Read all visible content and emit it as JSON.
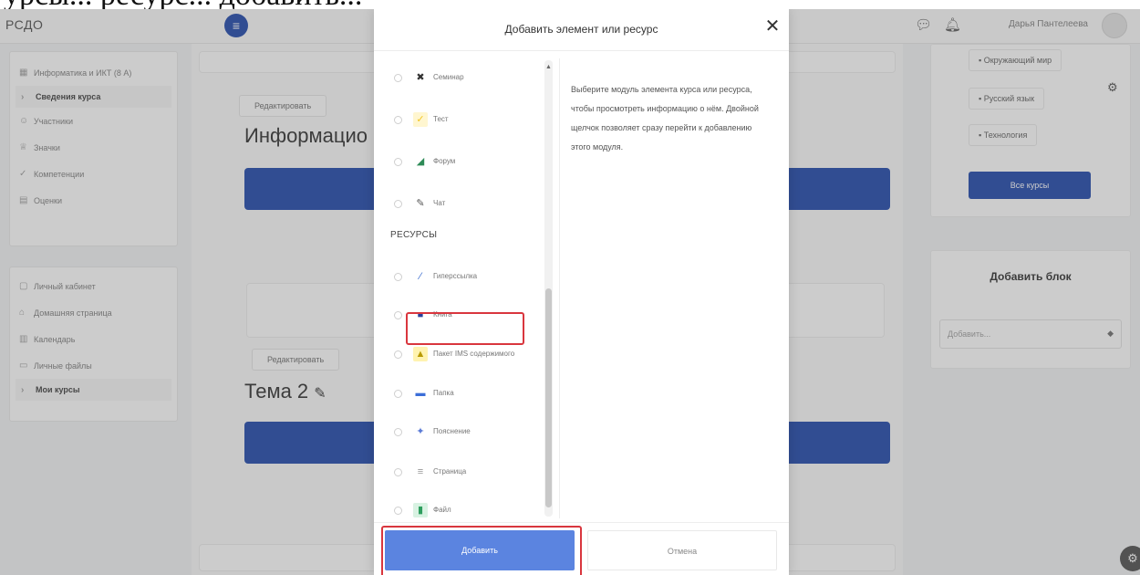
{
  "caption_fragment": "урсы... ресурс... добавить...",
  "app": {
    "brand": "РСДО",
    "user_name": "Дарья Пантелеева"
  },
  "sidebar": {
    "top_items": [
      {
        "label": "Информатика и ИКТ (8 А)",
        "icon": "grid-icon"
      },
      {
        "label": "Сведения курса",
        "icon": "chevron-icon"
      },
      {
        "label": "Участники",
        "icon": "users-icon"
      },
      {
        "label": "Значки",
        "icon": "badge-icon"
      },
      {
        "label": "Компетенции",
        "icon": "check-icon"
      },
      {
        "label": "Оценки",
        "icon": "table-icon"
      }
    ],
    "bottom_items": [
      {
        "label": "Личный кабинет",
        "icon": "dashboard-icon"
      },
      {
        "label": "Домашняя страница",
        "icon": "home-icon"
      },
      {
        "label": "Календарь",
        "icon": "calendar-icon"
      },
      {
        "label": "Личные файлы",
        "icon": "files-icon"
      },
      {
        "label": "Мои курсы",
        "icon": "chevron-icon"
      }
    ]
  },
  "center": {
    "edit_label_1": "Редактировать",
    "section_1_title": "Информацио",
    "edit_label_2": "Редактировать",
    "section_2_title": "Тема 2"
  },
  "right": {
    "courses": [
      "Окружающий мир",
      "Русский язык",
      "Технология"
    ],
    "all_courses_label": "Все курсы",
    "add_block_title": "Добавить блок",
    "add_block_placeholder": "Добавить..."
  },
  "modal": {
    "title": "Добавить элемент или ресурс",
    "activities": [
      {
        "label": "Семинар",
        "icon": "seminar-icon",
        "color": "#333333"
      },
      {
        "label": "Тест",
        "icon": "quiz-icon",
        "color": "#f3c623"
      },
      {
        "label": "Форум",
        "icon": "forum-icon",
        "color": "#2e8b57"
      },
      {
        "label": "Чат",
        "icon": "chat-icon",
        "color": "#555555"
      }
    ],
    "resources_heading": "РЕСУРСЫ",
    "resources": [
      {
        "label": "Гиперссылка",
        "icon": "link-icon",
        "color": "#3366cc"
      },
      {
        "label": "Книга",
        "icon": "book-icon",
        "color": "#2a3f9b"
      },
      {
        "label": "Пакет IMS содержимого",
        "icon": "ims-package-icon",
        "color": "#e6c200"
      },
      {
        "label": "Папка",
        "icon": "folder-icon",
        "color": "#3b6ed8"
      },
      {
        "label": "Пояснение",
        "icon": "label-icon",
        "color": "#5b7bd6"
      },
      {
        "label": "Страница",
        "icon": "page-icon",
        "color": "#999999"
      },
      {
        "label": "Файл",
        "icon": "file-icon",
        "color": "#2e9e5e"
      }
    ],
    "description": "Выберите модуль элемента курса или ресурса, чтобы просмотреть информацию о нём. Двойной щелчок позволяет сразу перейти к добавлению этого модуля.",
    "add_label": "Добавить",
    "cancel_label": "Отмена"
  }
}
